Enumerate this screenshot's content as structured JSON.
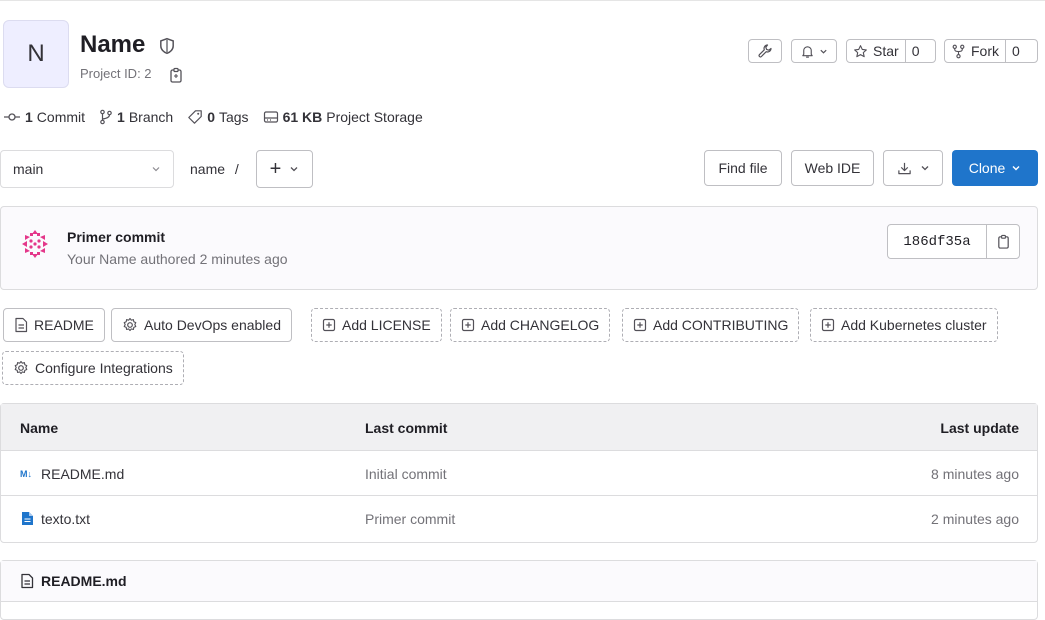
{
  "project": {
    "avatar_letter": "N",
    "name": "Name",
    "id_text": "Project ID: 2"
  },
  "header_actions": {
    "star_label": "Star",
    "star_count": "0",
    "fork_label": "Fork",
    "fork_count": "0"
  },
  "stats": {
    "commits_count": "1",
    "commits_label": "Commit",
    "branches_count": "1",
    "branches_label": "Branch",
    "tags_count": "0",
    "tags_label": "Tags",
    "storage_size": "61 KB",
    "storage_label": "Project Storage"
  },
  "toolbar": {
    "branch": "main",
    "path": "name",
    "path_separator": "/",
    "add_symbol": "+",
    "find_file": "Find file",
    "web_ide": "Web IDE",
    "clone": "Clone"
  },
  "last_commit": {
    "title": "Primer commit",
    "meta": "Your Name authored 2 minutes ago",
    "sha": "186df35a"
  },
  "chips": [
    {
      "label": "README",
      "style": "solid",
      "icon": "document-icon"
    },
    {
      "label": "Auto DevOps enabled",
      "style": "solid",
      "icon": "gear-icon"
    },
    {
      "label": "Add LICENSE",
      "style": "dashed",
      "icon": "plus-square-icon"
    },
    {
      "label": "Add CHANGELOG",
      "style": "dashed",
      "icon": "plus-square-icon"
    },
    {
      "label": "Add CONTRIBUTING",
      "style": "dashed",
      "icon": "plus-square-icon"
    },
    {
      "label": "Add Kubernetes cluster",
      "style": "dashed",
      "icon": "plus-square-icon"
    },
    {
      "label": "Configure Integrations",
      "style": "dashed",
      "icon": "gear-icon"
    }
  ],
  "files": {
    "headers": {
      "name": "Name",
      "last_commit": "Last commit",
      "last_update": "Last update"
    },
    "rows": [
      {
        "name": "README.md",
        "icon": "markdown-icon",
        "commit": "Initial commit",
        "updated": "8 minutes ago"
      },
      {
        "name": "texto.txt",
        "icon": "text-file-icon",
        "commit": "Primer commit",
        "updated": "2 minutes ago"
      }
    ]
  },
  "readme": {
    "title": "README.md"
  },
  "colors": {
    "primary": "#1f75cb",
    "markdown_icon": "#1f75cb",
    "avatar_bg": "#eeeeff",
    "commit_avatar": "#e4378a"
  }
}
